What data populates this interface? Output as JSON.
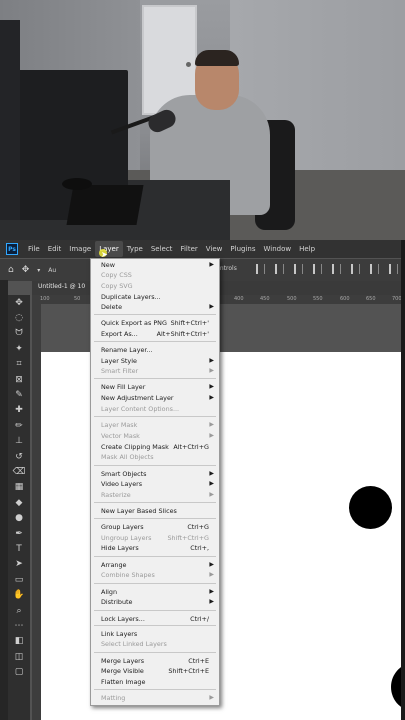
{
  "menubar": {
    "items": [
      "File",
      "Edit",
      "Image",
      "Layer",
      "Type",
      "Select",
      "Filter",
      "View",
      "Plugins",
      "Window",
      "Help"
    ],
    "active": "Layer",
    "logo": "Ps"
  },
  "options_bar": {
    "controls_label": "Controls",
    "auto_label": "Au"
  },
  "document": {
    "tab_label": "Untitled-1 @ 10"
  },
  "ruler": {
    "top_ticks": [
      "100",
      "50",
      "400",
      "450",
      "500",
      "550",
      "600",
      "650",
      "700",
      "750"
    ]
  },
  "layer_menu": {
    "items": [
      {
        "label": "New",
        "shortcut": "",
        "submenu": true,
        "disabled": false
      },
      {
        "label": "Copy CSS",
        "shortcut": "",
        "submenu": false,
        "disabled": true
      },
      {
        "label": "Copy SVG",
        "shortcut": "",
        "submenu": false,
        "disabled": true
      },
      {
        "label": "Duplicate Layers...",
        "shortcut": "",
        "submenu": false,
        "disabled": false
      },
      {
        "label": "Delete",
        "shortcut": "",
        "submenu": true,
        "disabled": false
      },
      {
        "label": "Quick Export as PNG",
        "shortcut": "Shift+Ctrl+'",
        "submenu": false,
        "disabled": false
      },
      {
        "label": "Export As...",
        "shortcut": "Alt+Shift+Ctrl+'",
        "submenu": false,
        "disabled": false
      },
      {
        "label": "Rename Layer...",
        "shortcut": "",
        "submenu": false,
        "disabled": false
      },
      {
        "label": "Layer Style",
        "shortcut": "",
        "submenu": true,
        "disabled": false
      },
      {
        "label": "Smart Filter",
        "shortcut": "",
        "submenu": true,
        "disabled": true
      },
      {
        "label": "New Fill Layer",
        "shortcut": "",
        "submenu": true,
        "disabled": false
      },
      {
        "label": "New Adjustment Layer",
        "shortcut": "",
        "submenu": true,
        "disabled": false
      },
      {
        "label": "Layer Content Options...",
        "shortcut": "",
        "submenu": false,
        "disabled": true
      },
      {
        "label": "Layer Mask",
        "shortcut": "",
        "submenu": true,
        "disabled": true
      },
      {
        "label": "Vector Mask",
        "shortcut": "",
        "submenu": true,
        "disabled": true
      },
      {
        "label": "Create Clipping Mask",
        "shortcut": "Alt+Ctrl+G",
        "submenu": false,
        "disabled": false
      },
      {
        "label": "Mask All Objects",
        "shortcut": "",
        "submenu": false,
        "disabled": true
      },
      {
        "label": "Smart Objects",
        "shortcut": "",
        "submenu": true,
        "disabled": false
      },
      {
        "label": "Video Layers",
        "shortcut": "",
        "submenu": true,
        "disabled": false
      },
      {
        "label": "Rasterize",
        "shortcut": "",
        "submenu": true,
        "disabled": true
      },
      {
        "label": "New Layer Based Slices",
        "shortcut": "",
        "submenu": false,
        "disabled": false
      },
      {
        "label": "Group Layers",
        "shortcut": "Ctrl+G",
        "submenu": false,
        "disabled": false
      },
      {
        "label": "Ungroup Layers",
        "shortcut": "Shift+Ctrl+G",
        "submenu": false,
        "disabled": true
      },
      {
        "label": "Hide Layers",
        "shortcut": "Ctrl+,",
        "submenu": false,
        "disabled": false
      },
      {
        "label": "Arrange",
        "shortcut": "",
        "submenu": true,
        "disabled": false
      },
      {
        "label": "Combine Shapes",
        "shortcut": "",
        "submenu": true,
        "disabled": true
      },
      {
        "label": "Align",
        "shortcut": "",
        "submenu": true,
        "disabled": false
      },
      {
        "label": "Distribute",
        "shortcut": "",
        "submenu": true,
        "disabled": false
      },
      {
        "label": "Lock Layers...",
        "shortcut": "Ctrl+/",
        "submenu": false,
        "disabled": false
      },
      {
        "label": "Link Layers",
        "shortcut": "",
        "submenu": false,
        "disabled": false
      },
      {
        "label": "Select Linked Layers",
        "shortcut": "",
        "submenu": false,
        "disabled": true
      },
      {
        "label": "Merge Layers",
        "shortcut": "Ctrl+E",
        "submenu": false,
        "disabled": false
      },
      {
        "label": "Merge Visible",
        "shortcut": "Shift+Ctrl+E",
        "submenu": false,
        "disabled": false
      },
      {
        "label": "Flatten Image",
        "shortcut": "",
        "submenu": false,
        "disabled": false
      },
      {
        "label": "Matting",
        "shortcut": "",
        "submenu": true,
        "disabled": true
      }
    ]
  },
  "tools": [
    "move-tool-icon",
    "marquee-tool-icon",
    "lasso-tool-icon",
    "magic-wand-icon",
    "crop-tool-icon",
    "frame-tool-icon",
    "eyedropper-icon",
    "healing-brush-icon",
    "brush-tool-icon",
    "clone-stamp-icon",
    "history-brush-icon",
    "eraser-tool-icon",
    "gradient-tool-icon",
    "blur-tool-icon",
    "dodge-tool-icon",
    "pen-tool-icon",
    "type-tool-icon",
    "path-selection-icon",
    "rectangle-tool-icon",
    "hand-tool-icon",
    "zoom-tool-icon",
    "more-tools-icon",
    "color-swatches-icon",
    "quick-mask-icon",
    "screen-mode-icon"
  ]
}
